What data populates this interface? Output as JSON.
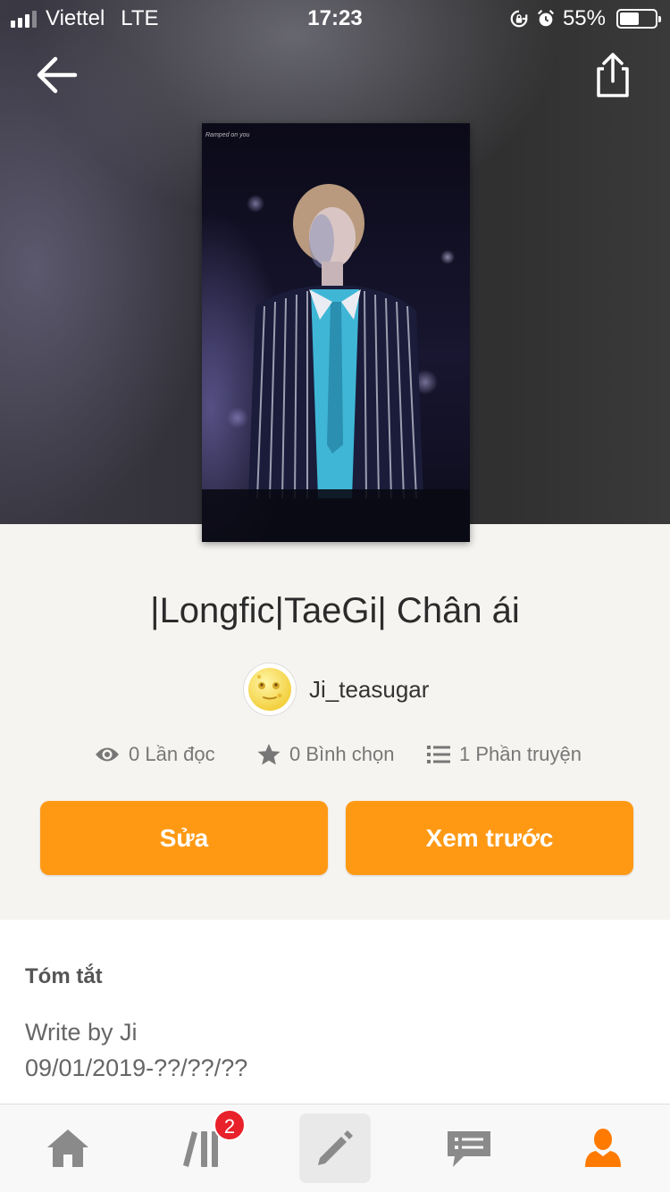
{
  "status_bar": {
    "carrier": "Viettel",
    "network": "LTE",
    "time": "17:23",
    "battery": "55%",
    "battery_level": 0.55,
    "signal_bars": 3
  },
  "header": {
    "back_icon": "arrow-left-icon",
    "share_icon": "share-icon",
    "cover_caption": "Ramped on you"
  },
  "story": {
    "title": "|Longfic|TaeGi| Chân ái",
    "author": "Ji_teasugar",
    "author_avatar": "full-moon-face-emoji"
  },
  "stats": {
    "reads": "0 Lần đọc",
    "votes": "0 Bình chọn",
    "parts": "1 Phần truyện"
  },
  "actions": {
    "edit_label": "Sửa",
    "preview_label": "Xem trước",
    "accent_color": "#ff9914"
  },
  "summary": {
    "heading": "Tóm tắt",
    "text": "Write by Ji\n09/01/2019-??/??/??"
  },
  "tabbar": {
    "tabs": [
      "home-icon",
      "library-icon",
      "write-icon",
      "messages-icon",
      "profile-icon"
    ],
    "library_badge": "2",
    "active_color": "#ff7a00"
  }
}
